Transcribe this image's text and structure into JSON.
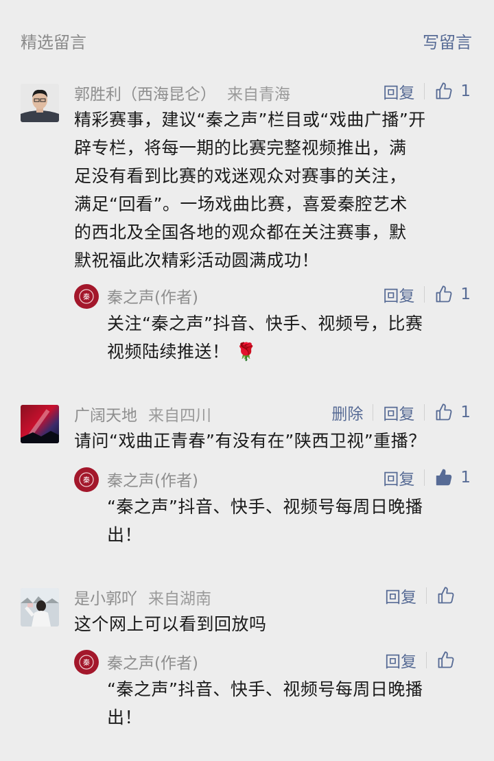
{
  "header": {
    "title": "精选留言",
    "write_label": "写留言"
  },
  "labels": {
    "reply": "回复",
    "delete": "删除"
  },
  "comments": [
    {
      "name": "郭胜利（西海昆仑）",
      "location": "来自青海",
      "text_lines": [
        "精彩赛事，建议“秦之声”栏目或“戏曲广播”开",
        "辟专栏，将每一期的比赛完整视频推出，满",
        "足没有看到比赛的戏迷观众对赛事的关注，",
        "满足“回看”。一场戏曲比赛，喜爱秦腔艺术",
        "的西北及全国各地的观众都在关注赛事，默",
        "默祝福此次精彩活动圆满成功！"
      ],
      "likes": "1",
      "reply": {
        "name": "秦之声(作者)",
        "text_lines": [
          "关注“秦之声”抖音、快手、视频号，比赛",
          "视频陆续推送！"
        ],
        "emoji": "🌹",
        "likes": "1"
      }
    },
    {
      "name": "广阔天地",
      "location": "来自四川",
      "text_lines": [
        "请问“戏曲正青春”有没有在”陕西卫视”重播？"
      ],
      "likes": "1",
      "reply": {
        "name": "秦之声(作者)",
        "text_lines": [
          "“秦之声”抖音、快手、视频号每周日晚播",
          "出！"
        ],
        "likes": "1"
      }
    },
    {
      "name": "是小郭吖",
      "location": "来自湖南",
      "text_lines": [
        "这个网上可以看到回放吗"
      ],
      "likes": "",
      "reply": {
        "name": "秦之声(作者)",
        "text_lines": [
          "“秦之声”抖音、快手、视频号每周日晚播",
          "出！"
        ],
        "likes": ""
      }
    }
  ]
}
